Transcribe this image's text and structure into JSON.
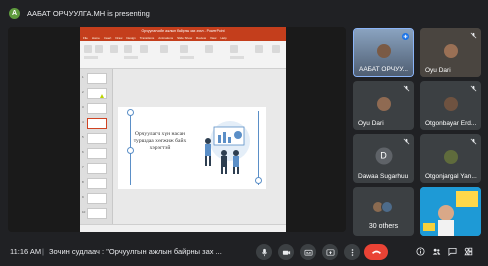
{
  "presenter": {
    "initial": "A",
    "text": "ААБАТ ОРЧУУЛГА.МН is presenting"
  },
  "ppt": {
    "title": "Орчуулагчийн ажлын байрны зах зээл - PowerPoint",
    "menu": [
      "File",
      "Home",
      "Insert",
      "Draw",
      "Design",
      "Transitions",
      "Animations",
      "Slide Show",
      "Review",
      "View",
      "Help"
    ],
    "slide_numbers": [
      "1",
      "2",
      "3",
      "4",
      "5",
      "6",
      "7",
      "8",
      "9",
      "10"
    ],
    "slide_text": "Орчуулагч хүн насан туршдаа хөгжиж байх хэрэгтэй"
  },
  "participants": [
    {
      "name": "ААБАТ ОРЧУУ...",
      "active": true
    },
    {
      "name": "Oyu Dari"
    },
    {
      "name": "Oyu Dari"
    },
    {
      "name": "Otgonbayar Erd..."
    },
    {
      "name": "Dawaa Sugarhuu",
      "initial": "D"
    },
    {
      "name": "Otgonjargal Yan..."
    }
  ],
  "others": {
    "label": "30 others"
  },
  "bottom": {
    "time": "11:16 AM",
    "separator": "|",
    "meeting_title": "Зочин судлаач : \"Орчуулгын ажлын байрны зах ..."
  },
  "icons": [
    "mic-icon",
    "camera-icon",
    "captions-icon",
    "present-icon",
    "more-icon",
    "hangup-icon",
    "info-icon",
    "people-icon",
    "chat-icon",
    "activities-icon"
  ],
  "colors": {
    "accent": "#8ab4f8",
    "hangup": "#ea4335",
    "ppt_brand": "#c43e1c"
  }
}
